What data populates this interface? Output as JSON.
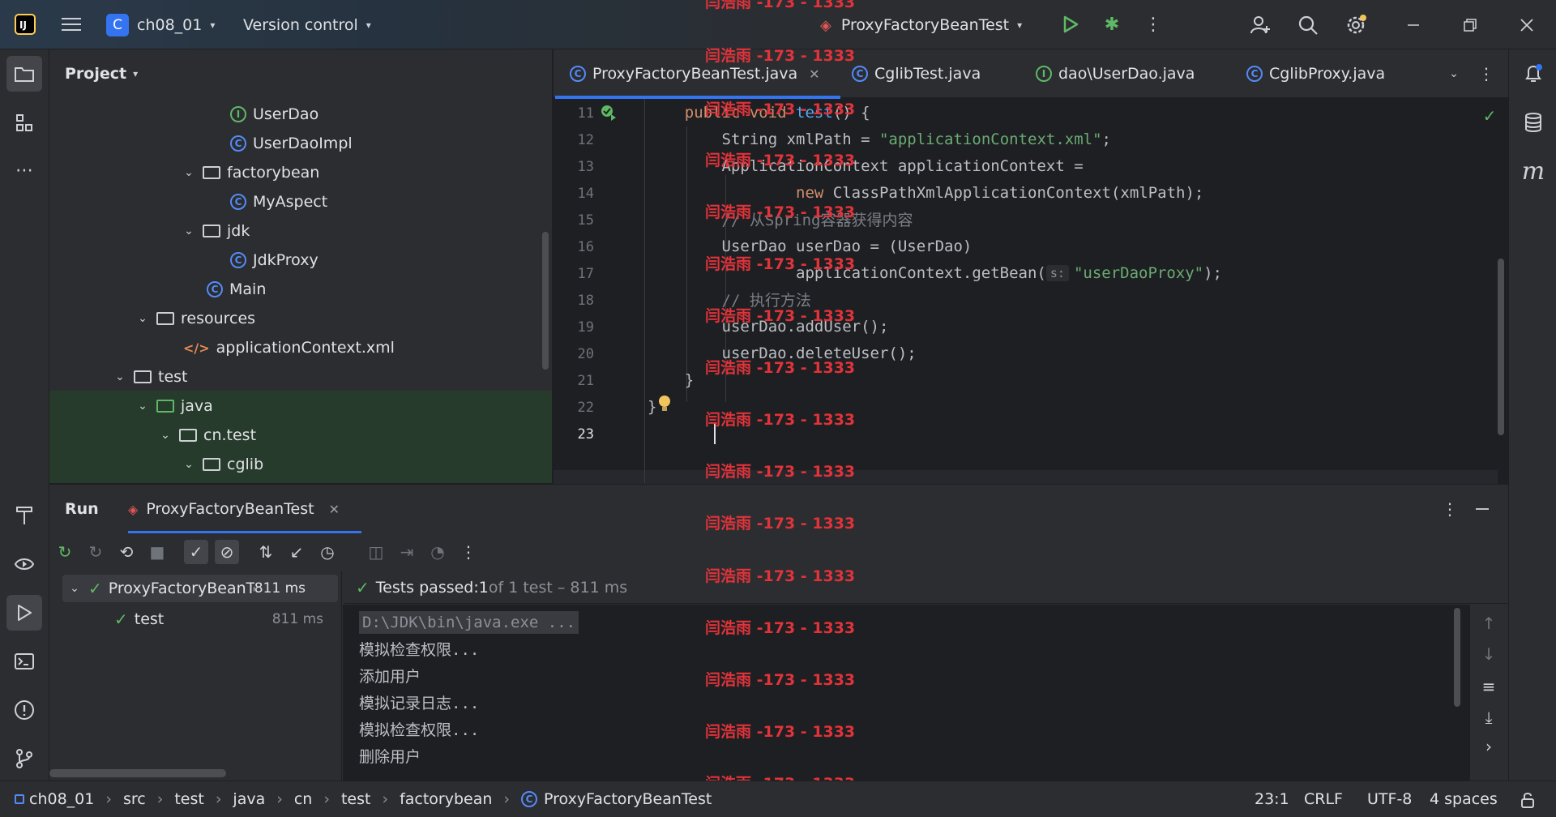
{
  "header": {
    "project_badge": "C",
    "project_name": "ch08_01",
    "vcs_label": "Version control",
    "run_config": "ProxyFactoryBeanTest"
  },
  "watermark": "闫浩雨 -173 - 1333",
  "project_panel": {
    "title": "Project",
    "tree": [
      {
        "label": "UserDao",
        "kind": "interface"
      },
      {
        "label": "UserDaoImpl",
        "kind": "class"
      },
      {
        "label": "factorybean",
        "kind": "package"
      },
      {
        "label": "MyAspect",
        "kind": "class"
      },
      {
        "label": "jdk",
        "kind": "package"
      },
      {
        "label": "JdkProxy",
        "kind": "class"
      },
      {
        "label": "Main",
        "kind": "class"
      },
      {
        "label": "resources",
        "kind": "folder"
      },
      {
        "label": "applicationContext.xml",
        "kind": "xml"
      },
      {
        "label": "test",
        "kind": "folder"
      },
      {
        "label": "java",
        "kind": "folder"
      },
      {
        "label": "cn.test",
        "kind": "package"
      },
      {
        "label": "cglib",
        "kind": "package"
      }
    ]
  },
  "editor": {
    "tabs": [
      {
        "label": "ProxyFactoryBeanTest.java",
        "active": true
      },
      {
        "label": "CglibTest.java",
        "active": false
      },
      {
        "label": "dao\\UserDao.java",
        "active": false
      },
      {
        "label": "CglibProxy.java",
        "active": false
      }
    ],
    "line_numbers": [
      "11",
      "12",
      "13",
      "14",
      "15",
      "16",
      "17",
      "18",
      "19",
      "20",
      "21",
      "22",
      "23"
    ],
    "code": {
      "l11a": "    public void ",
      "l11b": "test",
      "l11c": "() {",
      "l12a": "        String xmlPath = ",
      "l12b": "\"applicationContext.xml\"",
      "l12c": ";",
      "l13": "        ApplicationContext applicationContext =",
      "l14a": "                new ",
      "l14b": "ClassPathXmlApplicationContext(xmlPath);",
      "l15": "        // 从Spring容器获得内容",
      "l16": "        UserDao userDao = (UserDao)",
      "l17a": "                applicationContext.getBean(",
      "l17hint": "s:",
      "l17b": "\"userDaoProxy\"",
      "l17c": ");",
      "l18": "        // 执行方法",
      "l19": "        userDao.addUser();",
      "l20": "        userDao.deleteUser();",
      "l21": "    }",
      "l22": "}"
    }
  },
  "run_panel": {
    "tab_run": "Run",
    "tab_config": "ProxyFactoryBeanTest",
    "tree_root": "ProxyFactoryBeanTe:",
    "tree_root_time": "811 ms",
    "tree_child": "test",
    "tree_child_time": "811 ms",
    "status_prefix": "Tests passed: ",
    "status_count": "1",
    "status_suffix": " of 1 test – 811 ms",
    "console": [
      "D:\\JDK\\bin\\java.exe ...",
      "模拟检查权限...",
      "添加用户",
      "模拟记录日志...",
      "模拟检查权限...",
      "删除用户"
    ]
  },
  "statusbar": {
    "breadcrumbs": [
      "ch08_01",
      "src",
      "test",
      "java",
      "cn",
      "test",
      "factorybean",
      "ProxyFactoryBeanTest"
    ],
    "position": "23:1",
    "line_sep": "CRLF",
    "encoding": "UTF-8",
    "indent": "4 spaces"
  },
  "colors": {
    "accent": "#548af7",
    "success": "#5fb865",
    "watermark": "#e0333a"
  }
}
